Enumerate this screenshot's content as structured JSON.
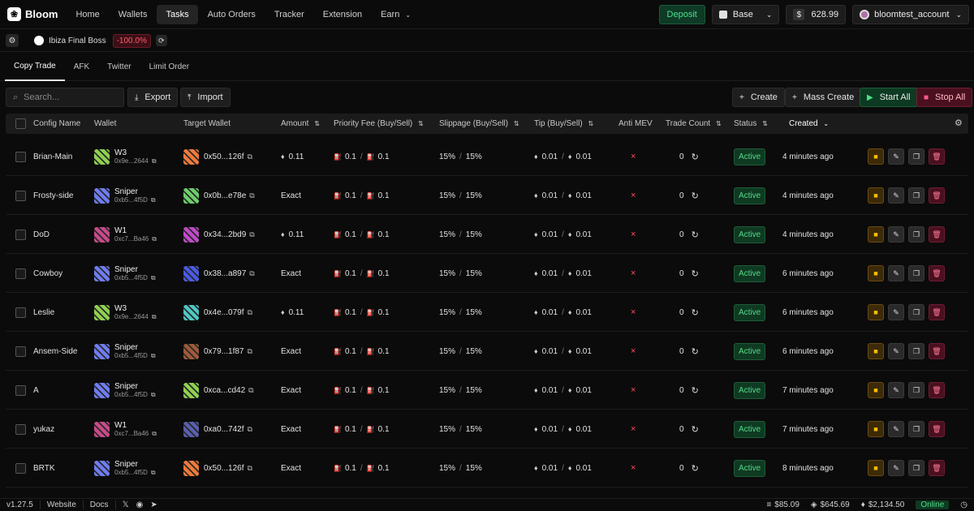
{
  "nav": {
    "brand": "Bloom",
    "items": [
      "Home",
      "Wallets",
      "Tasks",
      "Auto Orders",
      "Tracker",
      "Extension",
      "Earn"
    ],
    "active": "Tasks",
    "deposit_label": "Deposit",
    "chain": "Base",
    "balance_symbol": "$",
    "balance": "628.99",
    "account": "bloomtest_account"
  },
  "subbar": {
    "preset_name": "Ibiza Final Boss",
    "preset_change": "-100.0%"
  },
  "tabs": [
    "Copy Trade",
    "AFK",
    "Twitter",
    "Limit Order"
  ],
  "toolbar": {
    "search_placeholder": "Search...",
    "export_label": "Export",
    "import_label": "Import",
    "create_label": "Create",
    "mass_create_label": "Mass Create",
    "start_all_label": "Start All",
    "stop_all_label": "Stop All"
  },
  "table": {
    "headers": {
      "config_name": "Config Name",
      "wallet": "Wallet",
      "target_wallet": "Target Wallet",
      "amount": "Amount",
      "priority_fee": "Priority Fee (Buy/Sell)",
      "slippage": "Slippage (Buy/Sell)",
      "tip": "Tip (Buy/Sell)",
      "anti_mev": "Anti MEV",
      "trade_count": "Trade Count",
      "status": "Status",
      "created": "Created"
    },
    "rows": [
      {
        "name": "Brian-Main",
        "wallet": "W3",
        "wallet_addr": "0x9e...2644",
        "wallet_color": "#8fd14f",
        "target": "0x50...126f",
        "target_color": "#f07a3a",
        "amount": "0.11",
        "amount_eth": true,
        "fee_buy": "0.1",
        "fee_sell": "0.1",
        "slip_buy": "15%",
        "slip_sell": "15%",
        "tip_buy": "0.01",
        "tip_sell": "0.01",
        "anti_mev": "×",
        "trades": "0",
        "status": "Active",
        "created": "4 minutes ago"
      },
      {
        "name": "Frosty-side",
        "wallet": "Sniper",
        "wallet_addr": "0xb5...4f5D",
        "wallet_color": "#6f7df2",
        "target": "0x0b...e78e",
        "target_color": "#6ccf6a",
        "amount": "Exact",
        "amount_eth": false,
        "fee_buy": "0.1",
        "fee_sell": "0.1",
        "slip_buy": "15%",
        "slip_sell": "15%",
        "tip_buy": "0.01",
        "tip_sell": "0.01",
        "anti_mev": "×",
        "trades": "0",
        "status": "Active",
        "created": "4 minutes ago"
      },
      {
        "name": "DoD",
        "wallet": "W1",
        "wallet_addr": "0xc7...Ba46",
        "wallet_color": "#c84a8a",
        "target": "0x34...2bd9",
        "target_color": "#c04ac8",
        "amount": "0.11",
        "amount_eth": true,
        "fee_buy": "0.1",
        "fee_sell": "0.1",
        "slip_buy": "15%",
        "slip_sell": "15%",
        "tip_buy": "0.01",
        "tip_sell": "0.01",
        "anti_mev": "×",
        "trades": "0",
        "status": "Active",
        "created": "4 minutes ago"
      },
      {
        "name": "Cowboy",
        "wallet": "Sniper",
        "wallet_addr": "0xb5...4f5D",
        "wallet_color": "#6f7df2",
        "target": "0x38...a897",
        "target_color": "#4a5ae8",
        "amount": "Exact",
        "amount_eth": false,
        "fee_buy": "0.1",
        "fee_sell": "0.1",
        "slip_buy": "15%",
        "slip_sell": "15%",
        "tip_buy": "0.01",
        "tip_sell": "0.01",
        "anti_mev": "×",
        "trades": "0",
        "status": "Active",
        "created": "6 minutes ago"
      },
      {
        "name": "Leslie",
        "wallet": "W3",
        "wallet_addr": "0x9e...2644",
        "wallet_color": "#8fd14f",
        "target": "0x4e...079f",
        "target_color": "#4fc7c4",
        "amount": "0.11",
        "amount_eth": true,
        "fee_buy": "0.1",
        "fee_sell": "0.1",
        "slip_buy": "15%",
        "slip_sell": "15%",
        "tip_buy": "0.01",
        "tip_sell": "0.01",
        "anti_mev": "×",
        "trades": "0",
        "status": "Active",
        "created": "6 minutes ago"
      },
      {
        "name": "Ansem-Side",
        "wallet": "Sniper",
        "wallet_addr": "0xb5...4f5D",
        "wallet_color": "#6f7df2",
        "target": "0x79...1f87",
        "target_color": "#a05a3a",
        "amount": "Exact",
        "amount_eth": false,
        "fee_buy": "0.1",
        "fee_sell": "0.1",
        "slip_buy": "15%",
        "slip_sell": "15%",
        "tip_buy": "0.01",
        "tip_sell": "0.01",
        "anti_mev": "×",
        "trades": "0",
        "status": "Active",
        "created": "6 minutes ago"
      },
      {
        "name": "A",
        "wallet": "Sniper",
        "wallet_addr": "0xb5...4f5D",
        "wallet_color": "#6f7df2",
        "target": "0xca...cd42",
        "target_color": "#8ed14f",
        "amount": "Exact",
        "amount_eth": false,
        "fee_buy": "0.1",
        "fee_sell": "0.1",
        "slip_buy": "15%",
        "slip_sell": "15%",
        "tip_buy": "0.01",
        "tip_sell": "0.01",
        "anti_mev": "×",
        "trades": "0",
        "status": "Active",
        "created": "7 minutes ago"
      },
      {
        "name": "yukaz",
        "wallet": "W1",
        "wallet_addr": "0xc7...Ba46",
        "wallet_color": "#c84a8a",
        "target": "0xa0...742f",
        "target_color": "#5a5fb0",
        "amount": "Exact",
        "amount_eth": false,
        "fee_buy": "0.1",
        "fee_sell": "0.1",
        "slip_buy": "15%",
        "slip_sell": "15%",
        "tip_buy": "0.01",
        "tip_sell": "0.01",
        "anti_mev": "×",
        "trades": "0",
        "status": "Active",
        "created": "7 minutes ago"
      },
      {
        "name": "BRTK",
        "wallet": "Sniper",
        "wallet_addr": "0xb5...4f5D",
        "wallet_color": "#6f7df2",
        "target": "0x50...126f",
        "target_color": "#f07a3a",
        "amount": "Exact",
        "amount_eth": false,
        "fee_buy": "0.1",
        "fee_sell": "0.1",
        "slip_buy": "15%",
        "slip_sell": "15%",
        "tip_buy": "0.01",
        "tip_sell": "0.01",
        "anti_mev": "×",
        "trades": "0",
        "status": "Active",
        "created": "8 minutes ago"
      }
    ]
  },
  "footer": {
    "version": "v1.27.5",
    "website": "Website",
    "docs": "Docs",
    "price1": "$85.09",
    "price2": "$645.69",
    "price3": "$2,134.50",
    "online": "Online"
  },
  "colors": {
    "accent_green": "#4be08a",
    "danger": "#ff4c5c"
  }
}
